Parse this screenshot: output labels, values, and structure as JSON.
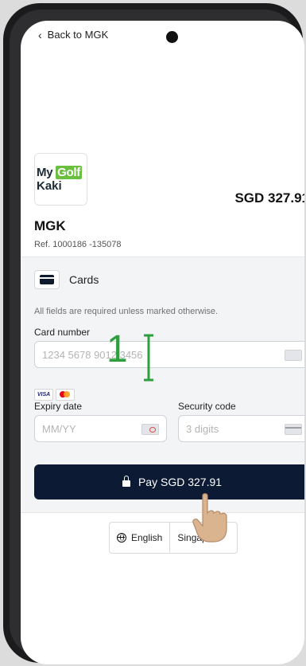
{
  "nav": {
    "back_label": "Back to MGK"
  },
  "merchant": {
    "logo_line1_a": "My",
    "logo_line1_b": "Golf",
    "logo_line2": "Kaki",
    "name": "MGK",
    "reference": "Ref. 1000186 -135078"
  },
  "order": {
    "amount": "SGD 327.91"
  },
  "payment_method": {
    "label": "Cards",
    "icon": "credit-card-icon"
  },
  "form": {
    "note": "All fields are required unless marked otherwise.",
    "card_number": {
      "label": "Card number",
      "placeholder": "1234 5678 9012 3456",
      "value": ""
    },
    "brands": [
      "VISA",
      "mastercard"
    ],
    "expiry": {
      "label": "Expiry date",
      "placeholder": "MM/YY",
      "value": ""
    },
    "security": {
      "label": "Security code",
      "placeholder": "3 digits",
      "value": ""
    },
    "pay_label": "Pay SGD 327.91"
  },
  "language": {
    "english": "English",
    "singapore": "Singapore"
  },
  "annotation": {
    "step": "1"
  },
  "colors": {
    "primary": "#0c1a33",
    "annotation": "#2e9f3f",
    "logo_green": "#6bbf3f"
  }
}
